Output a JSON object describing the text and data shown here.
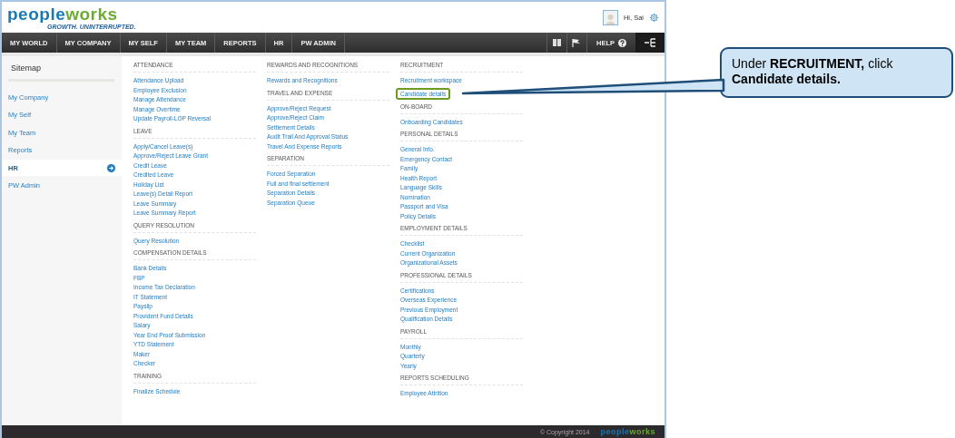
{
  "header": {
    "logo": "peopleworks",
    "tagline": "GROWTH. UNINTERRUPTED.",
    "greeting": "Hi, Sai"
  },
  "nav": {
    "items": [
      "MY WORLD",
      "MY COMPANY",
      "MY SELF",
      "MY TEAM",
      "REPORTS",
      "HR",
      "PW ADMIN"
    ],
    "help": "HELP"
  },
  "sidebar": {
    "title": "Sitemap",
    "items": [
      {
        "label": "My Company",
        "selected": false
      },
      {
        "label": "My Self",
        "selected": false
      },
      {
        "label": "My Team",
        "selected": false
      },
      {
        "label": "Reports",
        "selected": false
      },
      {
        "label": "HR",
        "selected": true
      },
      {
        "label": "PW Admin",
        "selected": false
      }
    ]
  },
  "columns": [
    {
      "sections": [
        {
          "heading": "ATTENDANCE",
          "links": [
            {
              "label": "Attendance Upload",
              "highlighted": false
            },
            {
              "label": "Employee Exclusion",
              "highlighted": false
            },
            {
              "label": "Manage Attendance",
              "highlighted": false
            },
            {
              "label": "Manage Overtime",
              "highlighted": false
            },
            {
              "label": "Update Payroll-LOP Reversal",
              "highlighted": false
            }
          ]
        },
        {
          "heading": "LEAVE",
          "links": [
            {
              "label": "Apply/Cancel Leave(s)",
              "highlighted": false
            },
            {
              "label": "Approve/Reject Leave Grant",
              "highlighted": false
            },
            {
              "label": "Credit Leave",
              "highlighted": false
            },
            {
              "label": "Credited Leave",
              "highlighted": false
            },
            {
              "label": "Holiday List",
              "highlighted": false
            },
            {
              "label": "Leave(s) Detail Report",
              "highlighted": false
            },
            {
              "label": "Leave Summary",
              "highlighted": false
            },
            {
              "label": "Leave Summary Report",
              "highlighted": false
            }
          ]
        },
        {
          "heading": "QUERY RESOLUTION",
          "links": [
            {
              "label": "Query Resolution",
              "highlighted": false
            }
          ]
        },
        {
          "heading": "COMPENSATION DETAILS",
          "links": [
            {
              "label": "Bank Details",
              "highlighted": false
            },
            {
              "label": "FBP",
              "highlighted": false
            },
            {
              "label": "Income Tax Declaration",
              "highlighted": false
            },
            {
              "label": "IT Statement",
              "highlighted": false
            },
            {
              "label": "Payslip",
              "highlighted": false
            },
            {
              "label": "Provident Fund Details",
              "highlighted": false
            },
            {
              "label": "Salary",
              "highlighted": false
            },
            {
              "label": "Year End Proof Submission",
              "highlighted": false
            },
            {
              "label": "YTD Statement",
              "highlighted": false
            },
            {
              "label": "Maker",
              "highlighted": false
            },
            {
              "label": "Checker",
              "highlighted": false
            }
          ]
        },
        {
          "heading": "TRAINING",
          "links": [
            {
              "label": "Finalize Schedule",
              "highlighted": false
            }
          ]
        }
      ]
    },
    {
      "sections": [
        {
          "heading": "REWARDS AND RECOGNITIONS",
          "links": [
            {
              "label": "Rewards and Recognitions",
              "highlighted": false
            }
          ]
        },
        {
          "heading": "TRAVEL AND EXPENSE",
          "links": [
            {
              "label": "Approve/Reject Request",
              "highlighted": false
            },
            {
              "label": "Approve/Reject Claim",
              "highlighted": false
            },
            {
              "label": "Settlement Details",
              "highlighted": false
            },
            {
              "label": "Audit Trail And Approval Status",
              "highlighted": false
            },
            {
              "label": "Travel And Expense Reports",
              "highlighted": false
            }
          ]
        },
        {
          "heading": "SEPARATION",
          "links": [
            {
              "label": "Forced Separation",
              "highlighted": false
            },
            {
              "label": "Full and final settlement",
              "highlighted": false
            },
            {
              "label": "Separation Details",
              "highlighted": false
            },
            {
              "label": "Separation Queue",
              "highlighted": false
            }
          ]
        }
      ]
    },
    {
      "sections": [
        {
          "heading": "RECRUITMENT",
          "links": [
            {
              "label": "Recruitment workspace",
              "highlighted": false
            },
            {
              "label": "Candidate details",
              "highlighted": true
            }
          ]
        },
        {
          "heading": "ON-BOARD",
          "links": [
            {
              "label": "Onboarding Candidates",
              "highlighted": false
            }
          ]
        },
        {
          "heading": "PERSONAL DETAILS",
          "links": [
            {
              "label": "General Info.",
              "highlighted": false
            },
            {
              "label": "Emergency Contact",
              "highlighted": false
            },
            {
              "label": "Family",
              "highlighted": false
            },
            {
              "label": "Health Report",
              "highlighted": false
            },
            {
              "label": "Language Skills",
              "highlighted": false
            },
            {
              "label": "Nomination",
              "highlighted": false
            },
            {
              "label": "Passport and Visa",
              "highlighted": false
            },
            {
              "label": "Policy Details",
              "highlighted": false
            }
          ]
        },
        {
          "heading": "EMPLOYMENT DETAILS",
          "links": [
            {
              "label": "Checklist",
              "highlighted": false
            },
            {
              "label": "Current Organization",
              "highlighted": false
            },
            {
              "label": "Organizational Assets",
              "highlighted": false
            }
          ]
        },
        {
          "heading": "PROFESSIONAL DETAILS",
          "links": [
            {
              "label": "Certifications",
              "highlighted": false
            },
            {
              "label": "Overseas Experience",
              "highlighted": false
            },
            {
              "label": "Previous Employment",
              "highlighted": false
            },
            {
              "label": "Qualification Details",
              "highlighted": false
            }
          ]
        },
        {
          "heading": "PAYROLL",
          "links": [
            {
              "label": "Monthly",
              "highlighted": false
            },
            {
              "label": "Quarterly",
              "highlighted": false
            },
            {
              "label": "Yearly",
              "highlighted": false
            }
          ]
        },
        {
          "heading": "REPORTS SCHEDULING",
          "links": [
            {
              "label": "Employee Attrition",
              "highlighted": false
            }
          ]
        }
      ]
    }
  ],
  "footer": {
    "copyright": "© Copyright 2014",
    "logo": "peopleworks"
  },
  "callout": {
    "text": "Under **RECRUITMENT,** click **Candidate details.**"
  }
}
